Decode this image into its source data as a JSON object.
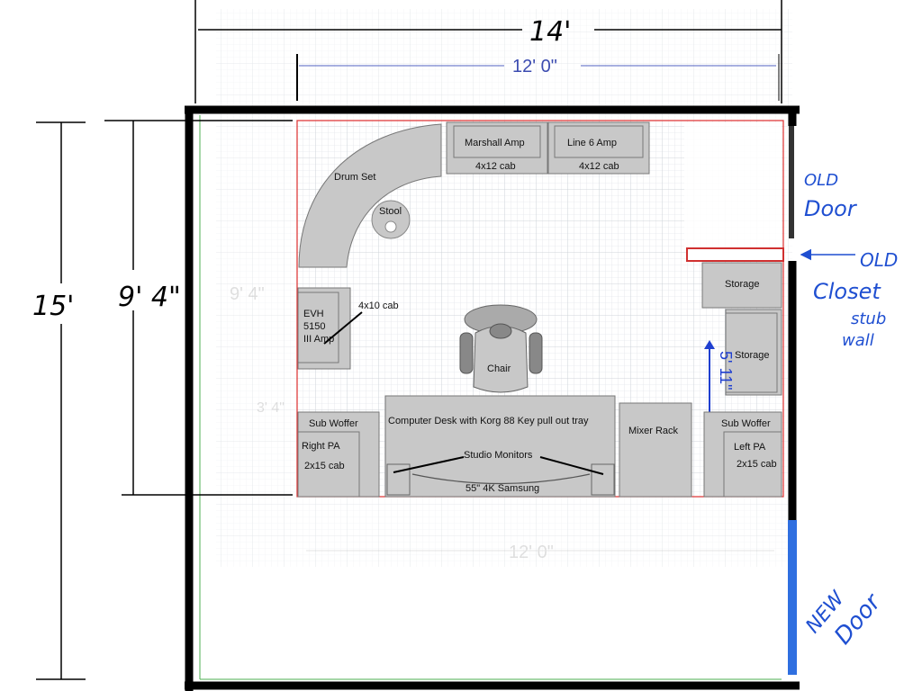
{
  "dimensions": {
    "room_width": "14'",
    "room_height": "15'",
    "inner_width": "12' 0\"",
    "inner_height": "9' 4\"",
    "storage_span": "5' 11\"",
    "ghost_height": "9' 4\"",
    "ghost_small": "3' 4\"",
    "ghost_bottom_width": "12' 0\""
  },
  "furniture": {
    "drum_set": "Drum Set",
    "stool": "Stool",
    "marshall_amp": "Marshall Amp",
    "marshall_cab": "4x12 cab",
    "line6_amp": "Line 6 Amp",
    "line6_cab": "4x12 cab",
    "evh_line1": "EVH",
    "evh_line2": "5150",
    "evh_line3": "III Amp",
    "evh_cab": "4x10 cab",
    "chair": "Chair",
    "storage_top": "Storage",
    "storage_side": "Storage",
    "sub_woofer_left": "Sub Woffer",
    "right_pa": "Right PA",
    "right_pa_cab": "2x15 cab",
    "desk": "Computer Desk with Korg 88 Key pull out tray",
    "studio_monitors": "Studio Monitors",
    "tv": "55\" 4K Samsung",
    "mixer_rack": "Mixer Rack",
    "sub_woofer_right": "Sub Woffer",
    "left_pa": "Left PA",
    "left_pa_cab": "2x15 cab"
  },
  "annotations": {
    "old_door_1": "OLD",
    "old_door_2": "Door",
    "old_closet_1": "OLD",
    "old_closet_2": "Closet",
    "old_closet_3": "stub",
    "old_closet_4": "wall",
    "new_door_1": "NEW",
    "new_door_2": "Door"
  },
  "colors": {
    "wall": "#000000",
    "new_door": "#2f6fe0",
    "old_wall": "#d03030",
    "grid": "#d8dde3",
    "furniture_fill": "#c8c8c8",
    "ink": "#1f4fd1"
  }
}
